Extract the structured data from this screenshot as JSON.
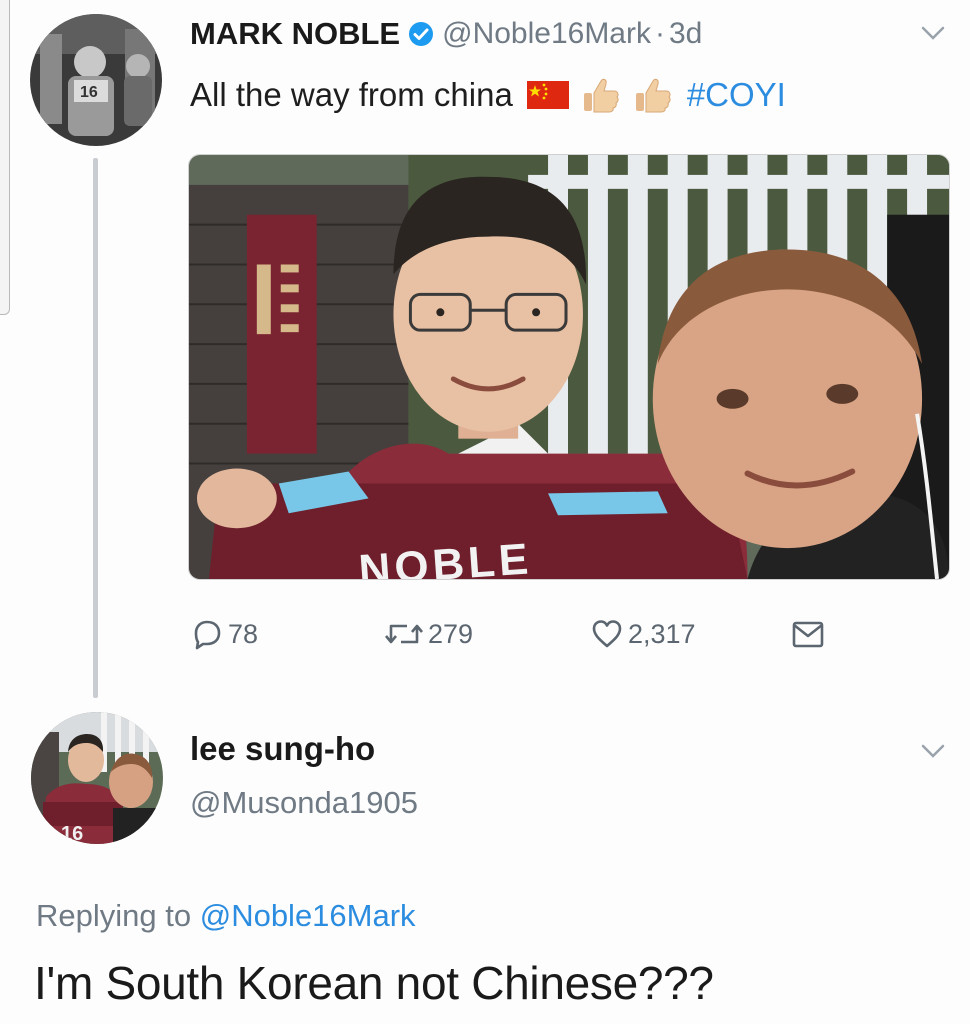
{
  "tweet": {
    "display_name": "MARK NOBLE",
    "handle": "@Noble16Mark",
    "separator": "·",
    "time": "3d",
    "text": "All the way from china",
    "hashtag": "#COYI",
    "media_shirt_text": "NOBLE",
    "stats": {
      "replies": "78",
      "retweets": "279",
      "likes": "2,317"
    }
  },
  "reply": {
    "display_name": "lee sung-ho",
    "handle": "@Musonda1905",
    "replying_prefix": "Replying to",
    "replying_to": "@Noble16Mark",
    "text": "I'm South Korean not Chinese???"
  },
  "icons": {
    "verified": "verified-badge-icon",
    "caret": "chevron-down-icon",
    "reply": "reply-bubble-icon",
    "retweet": "retweet-icon",
    "like": "heart-icon",
    "dm": "envelope-icon",
    "flag": "china-flag-emoji",
    "thumbs": "thumbs-up-emoji"
  },
  "colors": {
    "link": "#2c8de0",
    "verified": "#1d9bf0",
    "muted": "#6f7a84",
    "thread_line": "#c9cdd1",
    "claret": "#7a2431",
    "sky_blue": "#78c7e8"
  }
}
